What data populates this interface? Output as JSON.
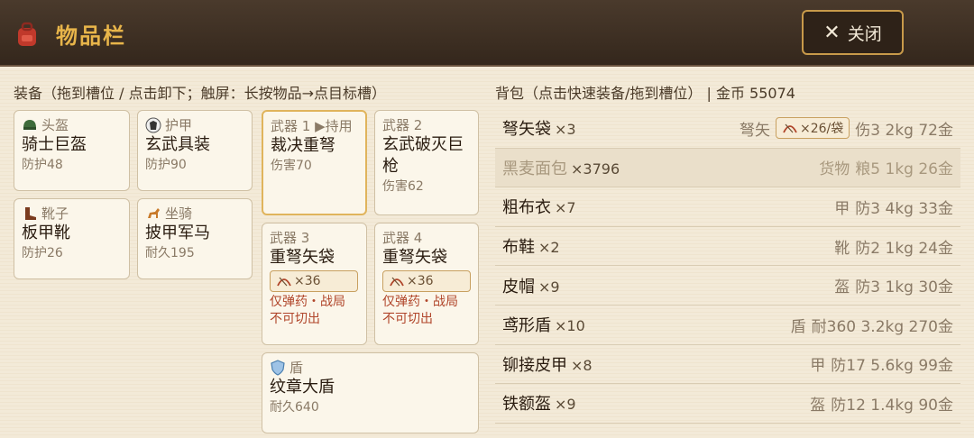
{
  "header": {
    "title": "物品栏",
    "close_label": "关闭"
  },
  "equip": {
    "hint": "装备（拖到槽位 / 点击卸下；触屏：长按物品→点目标槽）",
    "slots": [
      {
        "type": "头盔",
        "name": "骑士巨盔",
        "stat": "防护48"
      },
      {
        "type": "护甲",
        "name": "玄武具装",
        "stat": "防护90"
      },
      {
        "type": "武器 1 ▶持用",
        "name": "裁决重弩",
        "stat": "伤害70"
      },
      {
        "type": "武器 2",
        "name": "玄武破灭巨枪",
        "stat": "伤害62"
      },
      {
        "type": "靴子",
        "name": "板甲靴",
        "stat": "防护26"
      },
      {
        "type": "坐骑",
        "name": "披甲军马",
        "stat": "耐久195"
      },
      {
        "type": "武器 3",
        "name": "重弩矢袋",
        "ammo": "×36",
        "note1": "仅弹药・战局",
        "note2": "不可切出"
      },
      {
        "type": "武器 4",
        "name": "重弩矢袋",
        "ammo": "×36",
        "note1": "仅弹药・战局",
        "note2": "不可切出"
      },
      {
        "type": "盾",
        "name": "纹章大盾",
        "stat": "耐久640"
      }
    ]
  },
  "bag": {
    "hint": "背包（点击快速装备/拖到槽位）  |  金币 55074",
    "items": [
      {
        "name": "弩矢袋",
        "qty": "×3",
        "category": "弩矢",
        "badge": "×26/袋",
        "stats": "伤3 2kg 72金"
      },
      {
        "name": "黑麦面包",
        "qty": "×3796",
        "category": "货物",
        "stats": "粮5 1kg 26金"
      },
      {
        "name": "粗布衣",
        "qty": "×7",
        "category": "甲",
        "stats": "防3 4kg 33金"
      },
      {
        "name": "布鞋",
        "qty": "×2",
        "category": "靴",
        "stats": "防2 1kg 24金"
      },
      {
        "name": "皮帽",
        "qty": "×9",
        "category": "盔",
        "stats": "防3 1kg 30金"
      },
      {
        "name": "鸢形盾",
        "qty": "×10",
        "category": "盾",
        "stats": "耐360 3.2kg 270金"
      },
      {
        "name": "铆接皮甲",
        "qty": "×8",
        "category": "甲",
        "stats": "防17 5.6kg 99金"
      },
      {
        "name": "铁额盔",
        "qty": "×9",
        "category": "盔",
        "stats": "防12 1.4kg 90金"
      }
    ]
  },
  "colors": {
    "accent": "#e8b54a",
    "header_bg": "#34271c",
    "note_red": "#b0452a"
  },
  "icons": {
    "title": "backpack-icon",
    "helmet": "helmet-icon",
    "armor": "armor-icon",
    "boots": "boots-icon",
    "mount": "horse-icon",
    "shield": "shield-icon",
    "ammo": "bow-icon"
  }
}
